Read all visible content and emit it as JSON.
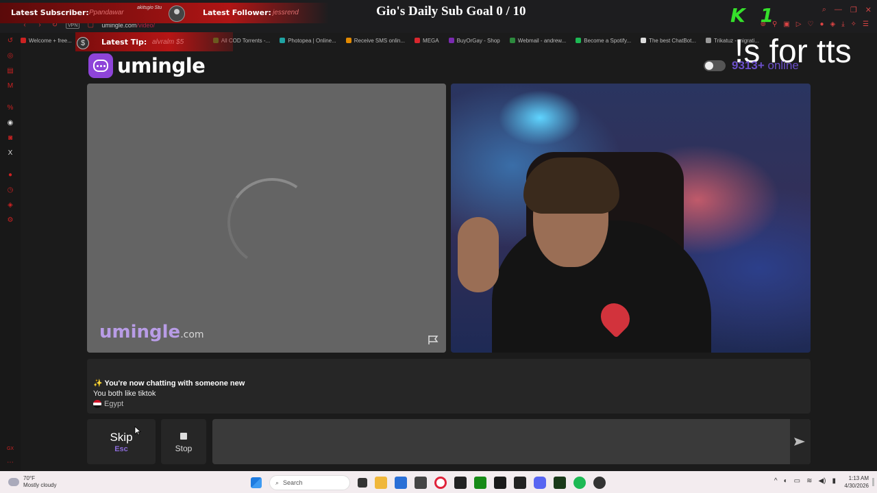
{
  "browser": {
    "url_domain": "umingle.com",
    "url_path": "/video/",
    "vpn": "VPN",
    "bookmarks": [
      {
        "label": "Welcome + free...",
        "color": "#cc2222"
      },
      {
        "label": "All COD Torrents -...",
        "color": "#2a9d2a"
      },
      {
        "label": "Photopea | Online...",
        "color": "#1fa3a3"
      },
      {
        "label": "Receive SMS onlin...",
        "color": "#e38a00"
      },
      {
        "label": "MEGA",
        "color": "#d9272e"
      },
      {
        "label": "BuyOrGay - Shop",
        "color": "#7a2ab0"
      },
      {
        "label": "Webmail - andrew...",
        "color": "#2d8a3e"
      },
      {
        "label": "Become a Spotify...",
        "color": "#1db954"
      },
      {
        "label": "The best ChatBot...",
        "color": "#dddddd"
      },
      {
        "label": "Trikatuz - migrati...",
        "color": "#999999"
      }
    ]
  },
  "overlay": {
    "latest_subscriber_label": "Latest Subscriber:",
    "latest_subscriber_value": "Ppandawar",
    "latest_subscriber_extra": "akitsgio Stu",
    "latest_follower_label": "Latest Follower:",
    "latest_follower_value": "jessrend",
    "latest_tip_label": "Latest Tip:",
    "latest_tip_value": "alvralm $5",
    "sub_goal": "Gio's Daily Sub Goal 0 / 10",
    "tts_text": "!s for tts",
    "kill_badge": "K 1"
  },
  "page": {
    "logo_text": "umingle",
    "online_count": "9313+",
    "online_label": "online",
    "watermark_brand": "umingle",
    "watermark_domain": ".com",
    "chat": {
      "line1": "✨ You're now chatting with someone new",
      "line2": "You both like tiktok",
      "country": "Egypt"
    },
    "skip_label": "Skip",
    "skip_key": "Esc",
    "stop_label": "Stop",
    "message_placeholder": ""
  },
  "taskbar": {
    "temperature": "70°F",
    "weather": "Mostly cloudy",
    "search_placeholder": "Search",
    "time": "1:13 AM",
    "date": "4/30/2026"
  },
  "colors": {
    "accent": "#8e44d9",
    "online": "#6b4fc9",
    "overlay_red": "#b01515"
  }
}
